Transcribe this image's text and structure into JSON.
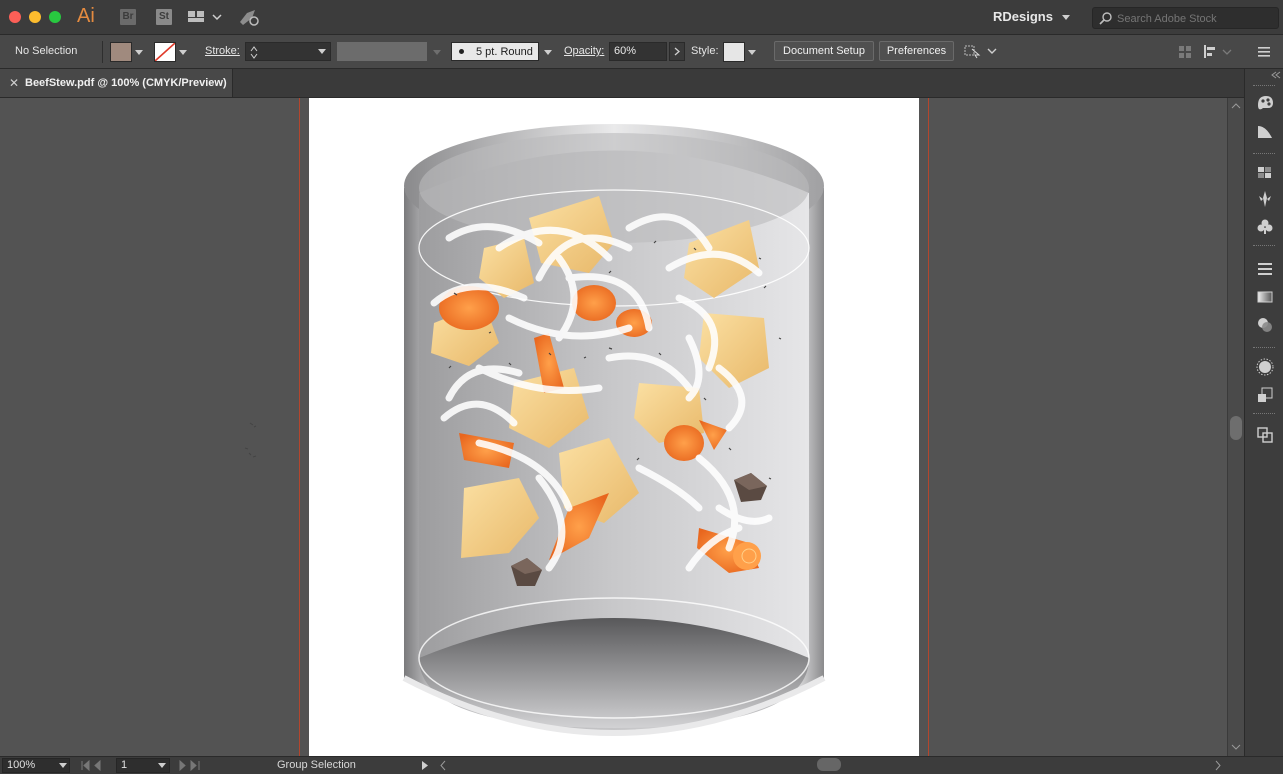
{
  "titlebar": {
    "app_icon_label": "Ai",
    "bridge_label": "Br",
    "stock_label": "St",
    "workspace": "RDesigns",
    "search_placeholder": "Search Adobe Stock"
  },
  "controlbar": {
    "selection_status": "No Selection",
    "stroke_label": "Stroke:",
    "brush_label": "5 pt. Round",
    "opacity_label": "Opacity:",
    "opacity_value": "60%",
    "style_label": "Style:",
    "document_setup_label": "Document Setup",
    "preferences_label": "Preferences",
    "fill_color": "#a08a7e"
  },
  "document": {
    "tab_title": "BeefStew.pdf @ 100% (CMYK/Preview)"
  },
  "statusbar": {
    "zoom": "100%",
    "artboard_number": "1",
    "status_text": "Group Selection"
  },
  "colors": {
    "accent_orange": "#f07b2a",
    "bleed_red": "#b4462d",
    "potato_yellow": "#f2c87a"
  }
}
